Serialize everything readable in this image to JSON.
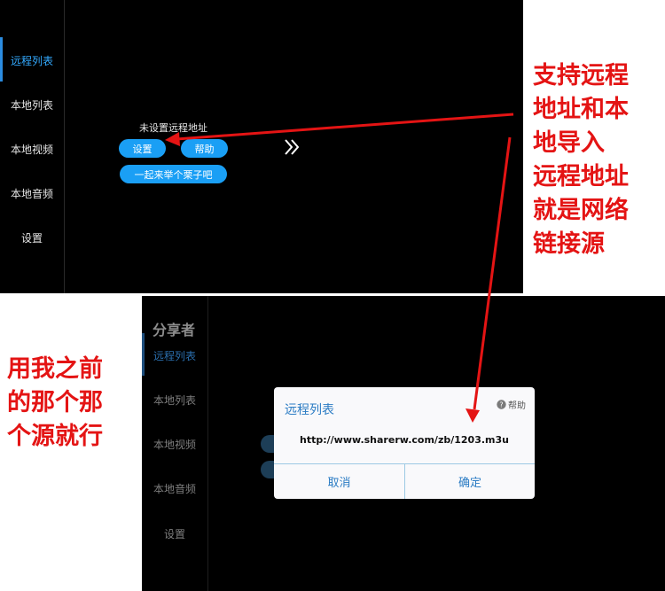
{
  "top_panel": {
    "sidebar": [
      {
        "label": "远程列表",
        "active": true
      },
      {
        "label": "本地列表",
        "active": false
      },
      {
        "label": "本地视频",
        "active": false
      },
      {
        "label": "本地音频",
        "active": false
      },
      {
        "label": "设置",
        "active": false
      }
    ],
    "status_text": "未设置远程地址",
    "settings_button": "设置",
    "help_button": "帮助",
    "example_button": "一起来举个栗子吧",
    "next_icon": "double-chevron-right-icon"
  },
  "bottom_panel": {
    "app_title": "分享者",
    "sidebar": [
      {
        "label": "远程列表",
        "active": true
      },
      {
        "label": "本地列表",
        "active": false
      },
      {
        "label": "本地视频",
        "active": false
      },
      {
        "label": "本地音频",
        "active": false
      },
      {
        "label": "设置",
        "active": false
      }
    ],
    "dialog": {
      "title": "远程列表",
      "help_label": "帮助",
      "help_icon": "question-circle-icon",
      "url_value": "http://www.sharerw.com/zb/1203.m3u",
      "cancel_label": "取消",
      "confirm_label": "确定"
    }
  },
  "annotations": {
    "right_note": [
      "支持远程",
      "地址和本",
      "地导入",
      "远程地址",
      "就是网络",
      "链接源"
    ],
    "left_note": [
      "用我之前",
      "的那个那",
      "个源就行"
    ]
  },
  "colors": {
    "accent": "#1a9ff5",
    "annotation": "#e41414",
    "dialog_accent": "#2b7cc4"
  }
}
